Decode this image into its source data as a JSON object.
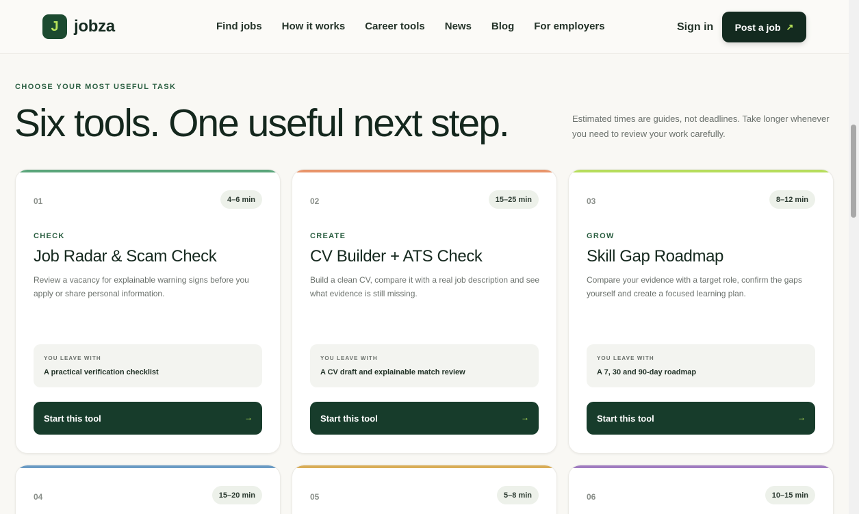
{
  "header": {
    "logo_letter": "J",
    "brand": "jobza",
    "nav": [
      "Find jobs",
      "How it works",
      "Career tools",
      "News",
      "Blog",
      "For employers"
    ],
    "signin": "Sign in",
    "post_job": "Post a job",
    "post_job_arrow": "↗"
  },
  "intro": {
    "eyebrow": "CHOOSE YOUR MOST USEFUL TASK",
    "headline": "Six tools. One useful next step.",
    "note": "Estimated times are guides, not deadlines. Take longer whenever you need to review your work carefully."
  },
  "cards": [
    {
      "num": "01",
      "time": "4–6 min",
      "category": "CHECK",
      "title": "Job Radar & Scam Check",
      "desc": "Review a vacancy for explainable warning signs before you apply or share personal information.",
      "leave_label": "YOU LEAVE WITH",
      "leave_value": "A practical verification checklist",
      "button": "Start this tool",
      "arrow": "→",
      "color": "#5aa57a"
    },
    {
      "num": "02",
      "time": "15–25 min",
      "category": "CREATE",
      "title": "CV Builder + ATS Check",
      "desc": "Build a clean CV, compare it with a real job description and see what evidence is still missing.",
      "leave_label": "YOU LEAVE WITH",
      "leave_value": "A CV draft and explainable match review",
      "button": "Start this tool",
      "arrow": "→",
      "color": "#e8946a"
    },
    {
      "num": "03",
      "time": "8–12 min",
      "category": "GROW",
      "title": "Skill Gap Roadmap",
      "desc": "Compare your evidence with a target role, confirm the gaps yourself and create a focused learning plan.",
      "leave_label": "YOU LEAVE WITH",
      "leave_value": "A 7, 30 and 90-day roadmap",
      "button": "Start this tool",
      "arrow": "→",
      "color": "#b6dd5c"
    },
    {
      "num": "04",
      "time": "15–20 min",
      "color": "#6a9bc4"
    },
    {
      "num": "05",
      "time": "5–8 min",
      "color": "#d9ad57"
    },
    {
      "num": "06",
      "time": "10–15 min",
      "color": "#a07cc0"
    }
  ]
}
